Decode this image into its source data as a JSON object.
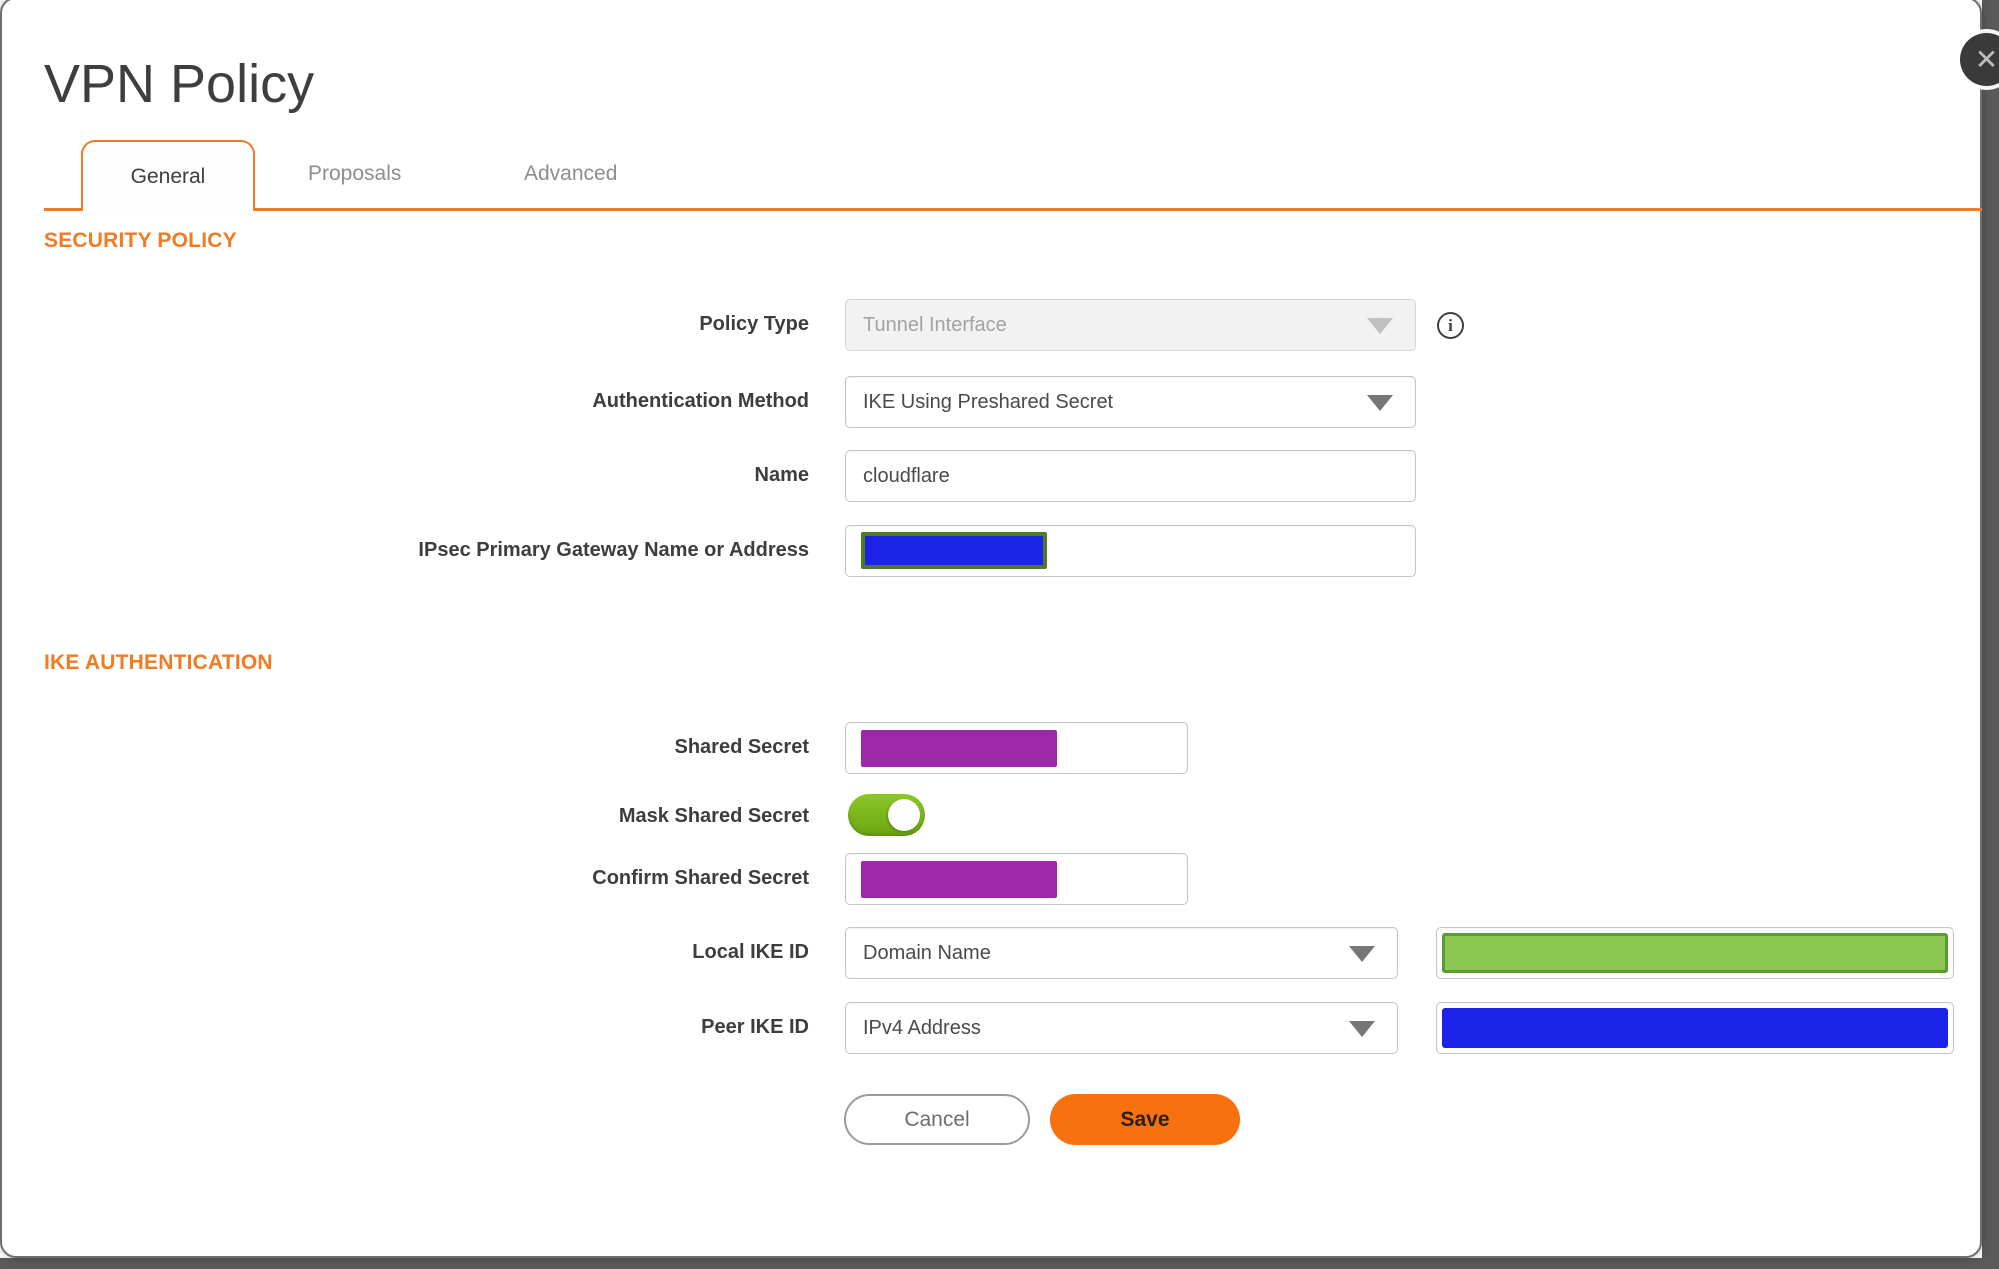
{
  "dialog": {
    "title": "VPN Policy"
  },
  "icons": {
    "close": "✕",
    "info": "i"
  },
  "tabs": {
    "items": [
      {
        "label": "General",
        "active": true
      },
      {
        "label": "Proposals",
        "active": false
      },
      {
        "label": "Advanced",
        "active": false
      }
    ]
  },
  "sections": {
    "security_policy": "SECURITY POLICY",
    "ike_authentication": "IKE AUTHENTICATION"
  },
  "fields": {
    "policy_type": {
      "label": "Policy Type",
      "value": "Tunnel Interface",
      "disabled": true
    },
    "auth_method": {
      "label": "Authentication Method",
      "value": "IKE Using Preshared Secret"
    },
    "name": {
      "label": "Name",
      "value": "cloudflare"
    },
    "gateway": {
      "label": "IPsec Primary Gateway Name or Address",
      "value": "",
      "redaction": "blue box with olive border"
    },
    "shared_secret": {
      "label": "Shared Secret",
      "value": "",
      "redaction": "purple box"
    },
    "mask_shared_secret": {
      "label": "Mask Shared Secret",
      "state": "on"
    },
    "confirm_shared_secret": {
      "label": "Confirm Shared Secret",
      "value": "",
      "redaction": "purple box"
    },
    "local_ike_id": {
      "label": "Local IKE ID",
      "type_value": "Domain Name",
      "redaction": "green box"
    },
    "peer_ike_id": {
      "label": "Peer IKE ID",
      "type_value": "IPv4 Address",
      "redaction": "blue box"
    }
  },
  "buttons": {
    "cancel": "Cancel",
    "save": "Save"
  },
  "colors": {
    "accent_orange": "#F07B22",
    "save_orange": "#F7710E",
    "toggle_green": "#8CC826",
    "toggle_green_dark": "#6CA412",
    "redact_purple": "#9D27A9",
    "redact_blue": "#1B23E8",
    "redact_green": "#8CC653",
    "redact_green_border": "#5C9B31",
    "olive_border": "#4F7A22",
    "band_gray": "#5A5A5A"
  }
}
